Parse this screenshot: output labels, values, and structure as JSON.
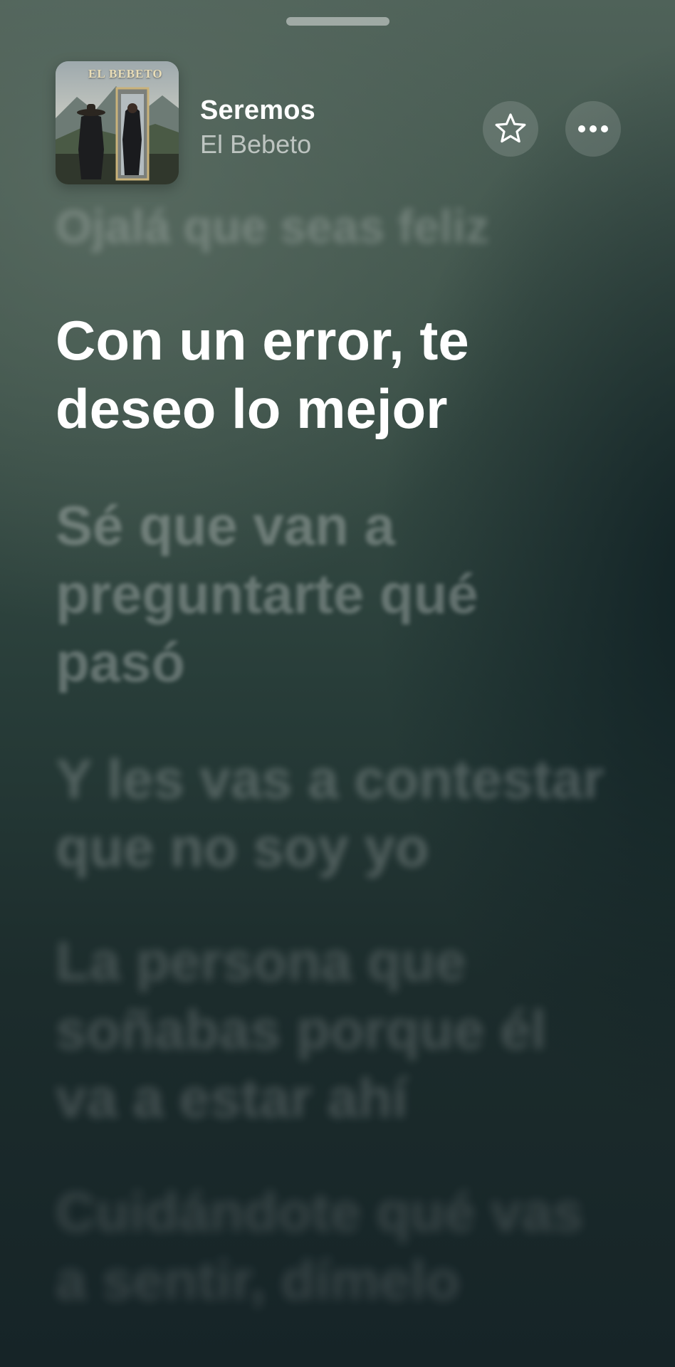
{
  "player": {
    "song_title": "Seremos",
    "artist": "El Bebeto",
    "artwork_label": "El Bebeto",
    "actions": {
      "favorite_icon": "star-icon",
      "more_icon": "more-icon"
    }
  },
  "lyrics": {
    "previous": {
      "lines": [
        "Ojalá que seas feliz"
      ]
    },
    "current": {
      "lines": [
        "Con un error, te",
        "deseo lo mejor"
      ]
    },
    "upcoming": [
      {
        "lines": [
          "Sé que van a",
          "preguntarte qué",
          "pasó"
        ]
      },
      {
        "lines": [
          "Y les vas a contestar",
          "que no soy yo"
        ]
      },
      {
        "lines": [
          "La persona que",
          "soñabas porque él",
          "va a estar ahí"
        ]
      },
      {
        "lines": [
          "Cuidándote qué vas",
          "a sentir, dímelo"
        ]
      }
    ]
  },
  "colors": {
    "background_top": "#4f6259",
    "background_bottom": "#162427",
    "current_lyric": "#ffffff"
  }
}
